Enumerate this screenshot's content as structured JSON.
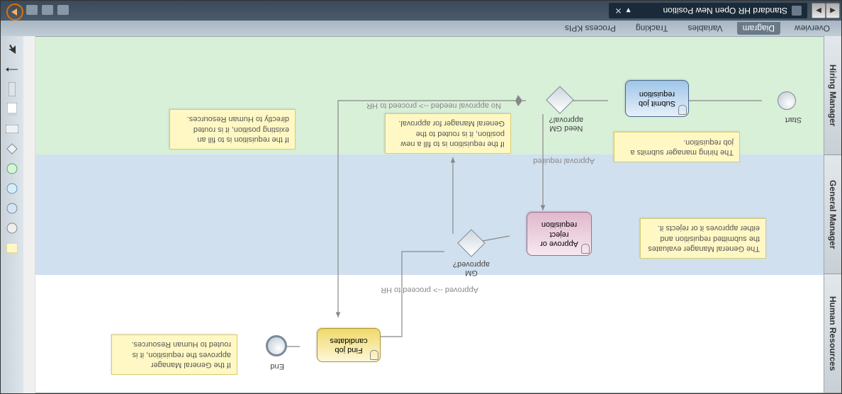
{
  "title_bar": {
    "doc_title": "Standard HR Open New Position",
    "doc_menu_marker": "▾",
    "close_marker": "✕",
    "nav_left": "◀",
    "nav_right": "▶"
  },
  "tabs": {
    "overview": "Overview",
    "diagram": "Diagram",
    "variables": "Variables",
    "tracking": "Tracking",
    "kpis": "Process KPIs"
  },
  "palette": {
    "items": [
      "note-icon",
      "event-icon",
      "event2-icon",
      "event3-icon",
      "event4-icon",
      "gateway-icon",
      "task-icon",
      "lane-icon",
      "milestone-icon",
      "arrow-icon",
      "pointer-icon"
    ]
  },
  "lanes": {
    "lane0_label": "Human Resources",
    "lane1_label": "General Manager",
    "lane2_label": "Hiring Manager"
  },
  "events": {
    "start_label": "Start",
    "end_label": "End"
  },
  "gateways": {
    "gw1_label": "Need GM\napproval?",
    "gw2_label": "GM\napproved?"
  },
  "tasks": {
    "submit": "Submit job\nrequisition",
    "approve": "Approve or\nreject\nrequisition",
    "find": "Find job\ncandidates"
  },
  "edges": {
    "approval_required": "Approval required",
    "no_approval": "No approval needed --> proceed to HR",
    "approved_to_hr": "Approved --> proceed to HR"
  },
  "notes": {
    "n_submit": "The hiring manager submits a job requisition.",
    "n_route_gm": "If the requisition is to fill a new position, it is routed to the General Manager for approval.",
    "n_existing": "If the requisition is to fill an existing position, it is routed directly to Human Resources.",
    "n_gm_eval": "The General Manager evaluates the submitted requisition and either approves it or rejects it.",
    "n_gm_routed": "If the General Manager approves the requisition, it is routed to Human Resources."
  }
}
